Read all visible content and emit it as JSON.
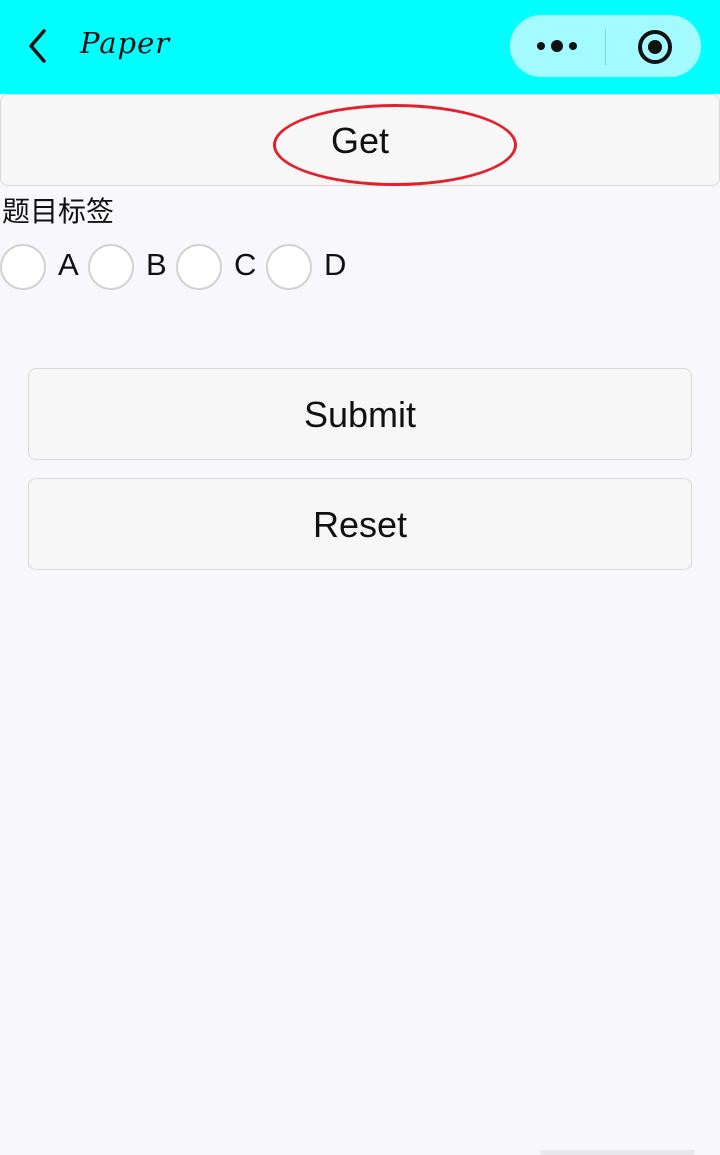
{
  "nav": {
    "title": "Paper",
    "background": "#00ffff"
  },
  "buttons": {
    "get": "Get",
    "submit": "Submit",
    "reset": "Reset"
  },
  "question": {
    "tag_label": "题目标签",
    "options": [
      "A",
      "B",
      "C",
      "D"
    ]
  },
  "colors": {
    "highlight": "#e3202c"
  },
  "icons": [
    "back-arrow-icon",
    "more-dots-icon",
    "close-target-icon"
  ]
}
